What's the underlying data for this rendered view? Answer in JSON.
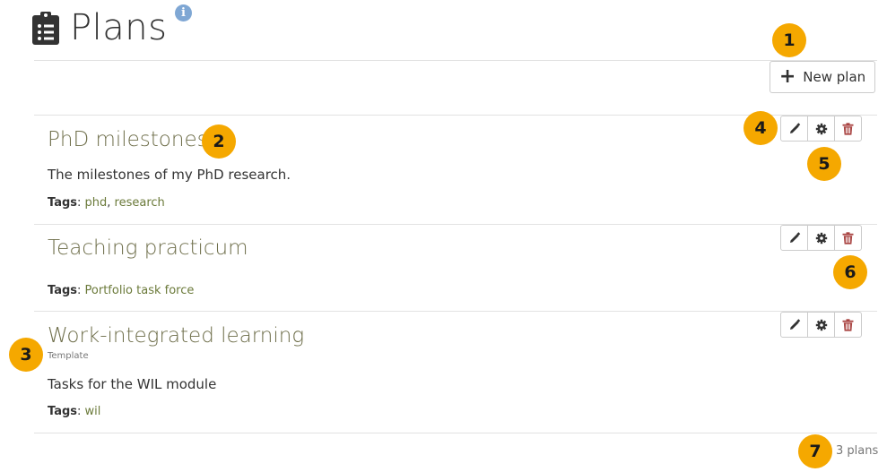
{
  "header": {
    "title": "Plans",
    "icon": "clipboard-list-icon",
    "info_icon": "info-icon",
    "info_symbol": "i"
  },
  "toolbar": {
    "new_plan_label": "New plan",
    "new_plan_icon_symbol": "+"
  },
  "plans": [
    {
      "title": "PhD milestones",
      "description": "The milestones of my PhD research.",
      "tags_label": "Tags",
      "tags": [
        "phd",
        "research"
      ],
      "template": ""
    },
    {
      "title": "Teaching practicum",
      "description": "",
      "tags_label": "Tags",
      "tags": [
        "Portfolio task force"
      ],
      "template": ""
    },
    {
      "title": "Work-integrated learning",
      "description": "Tasks for the WIL module",
      "tags_label": "Tags",
      "tags": [
        "wil"
      ],
      "template": "Template"
    }
  ],
  "footer": {
    "count_text": "3 plans"
  },
  "callouts": [
    "1",
    "2",
    "3",
    "4",
    "5",
    "6",
    "7"
  ],
  "colors": {
    "callout": "#f5a800",
    "title_link": "#6e6e4a",
    "tag_link": "#6b7a3a",
    "delete": "#a94442",
    "info": "#7fa7d4"
  }
}
